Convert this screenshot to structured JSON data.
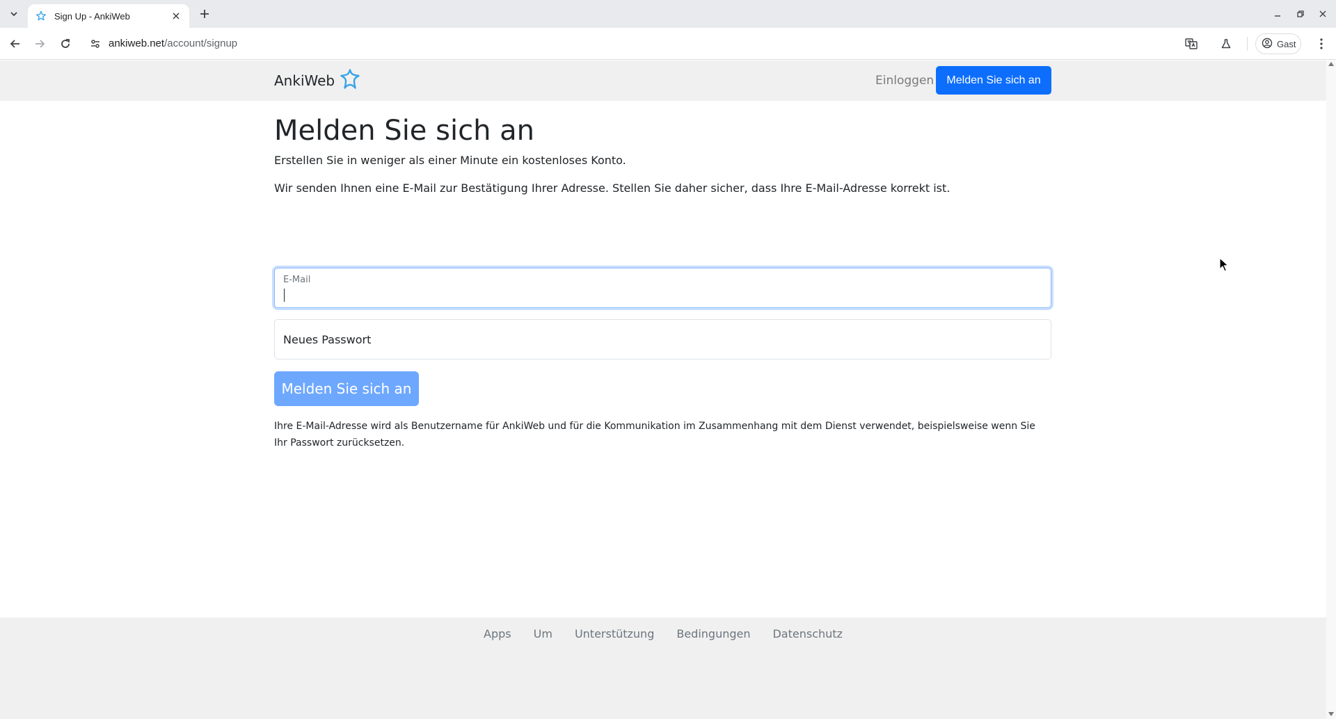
{
  "browser": {
    "tab_title": "Sign Up - AnkiWeb",
    "url_host": "ankiweb.net",
    "url_path": "/account/signup",
    "profile_label": "Gast",
    "accent_color": "#0b57d0"
  },
  "nav": {
    "brand": "AnkiWeb",
    "login_label": "Einloggen",
    "signup_label": "Melden Sie sich an"
  },
  "main": {
    "title": "Melden Sie sich an",
    "lead1": "Erstellen Sie in weniger als einer Minute ein kostenloses Konto.",
    "lead2": "Wir senden Ihnen eine E-Mail zur Bestätigung Ihrer Adresse. Stellen Sie daher sicher, dass Ihre E-Mail-Adresse korrekt ist.",
    "email_label": "E-Mail",
    "email_value": "",
    "password_placeholder": "Neues Passwort",
    "submit_label": "Melden Sie sich an",
    "note": "Ihre E-Mail-Adresse wird als Benutzername für AnkiWeb und für die Kommunikation im Zusammenhang mit dem Dienst verwendet, beispielsweise wenn Sie Ihr Passwort zurücksetzen."
  },
  "footer": {
    "links": [
      "Apps",
      "Um",
      "Unterstützung",
      "Bedingungen",
      "Datenschutz"
    ]
  },
  "colors": {
    "primary": "#0d6efd",
    "primary_disabled": "#6ea8fe",
    "nav_bg": "#f0f0f0",
    "star_logo": "#36a3e8"
  }
}
